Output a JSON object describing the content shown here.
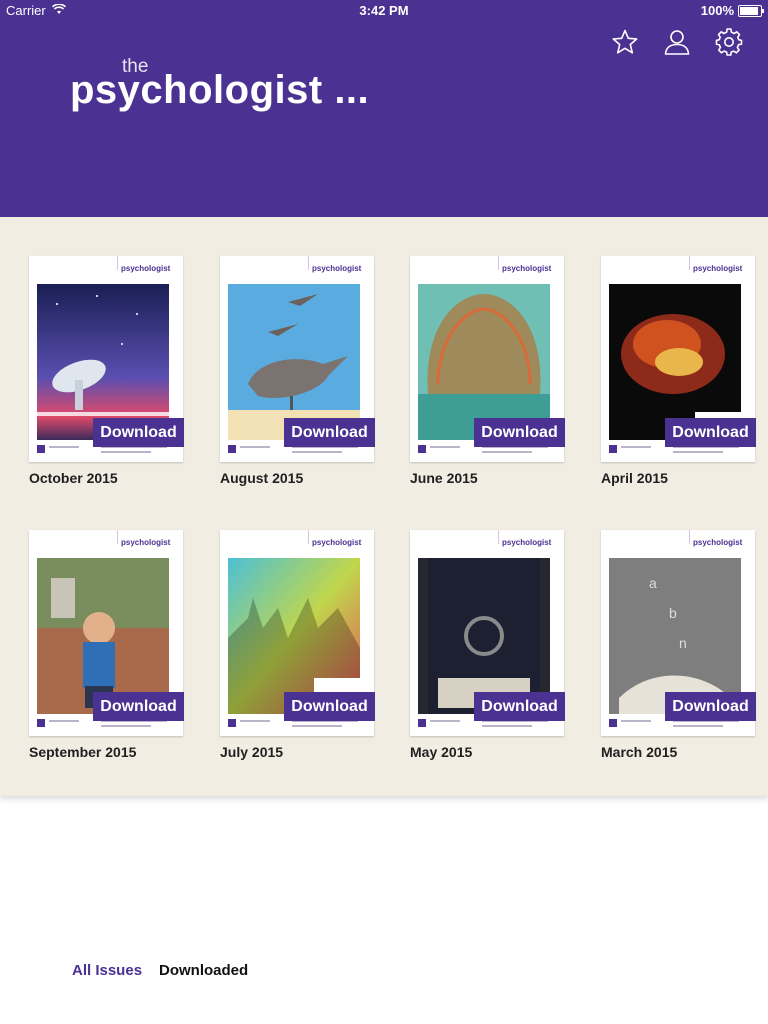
{
  "status_bar": {
    "carrier": "Carrier",
    "time": "3:42 PM",
    "battery": "100%",
    "battery_level": 1.0
  },
  "header": {
    "logo_small": "the",
    "logo_main": "psychologist ...",
    "icons": [
      "star-icon",
      "user-icon",
      "gear-icon"
    ],
    "background": "#4b3192"
  },
  "issues": [
    {
      "label": "October 2015",
      "button": "Download",
      "cover_text": "psychologist"
    },
    {
      "label": "August 2015",
      "button": "Download",
      "cover_text": "psychologist"
    },
    {
      "label": "June 2015",
      "button": "Download",
      "cover_text": "psychologist"
    },
    {
      "label": "April 2015",
      "button": "Download",
      "cover_text": "psychologist"
    },
    {
      "label": "September 2015",
      "button": "Download",
      "cover_text": "psychologist"
    },
    {
      "label": "July 2015",
      "button": "Download",
      "cover_text": "psychologist"
    },
    {
      "label": "May 2015",
      "button": "Download",
      "cover_text": "psychologist"
    },
    {
      "label": "March 2015",
      "button": "Download",
      "cover_text": "psychologist"
    }
  ],
  "tabs": [
    {
      "label": "All Issues",
      "active": true,
      "color": "#4b3192"
    },
    {
      "label": "Downloaded",
      "active": false,
      "color": "#111111"
    }
  ],
  "colors": {
    "accent": "#4b3192",
    "grid_background": "#f1ede3"
  }
}
